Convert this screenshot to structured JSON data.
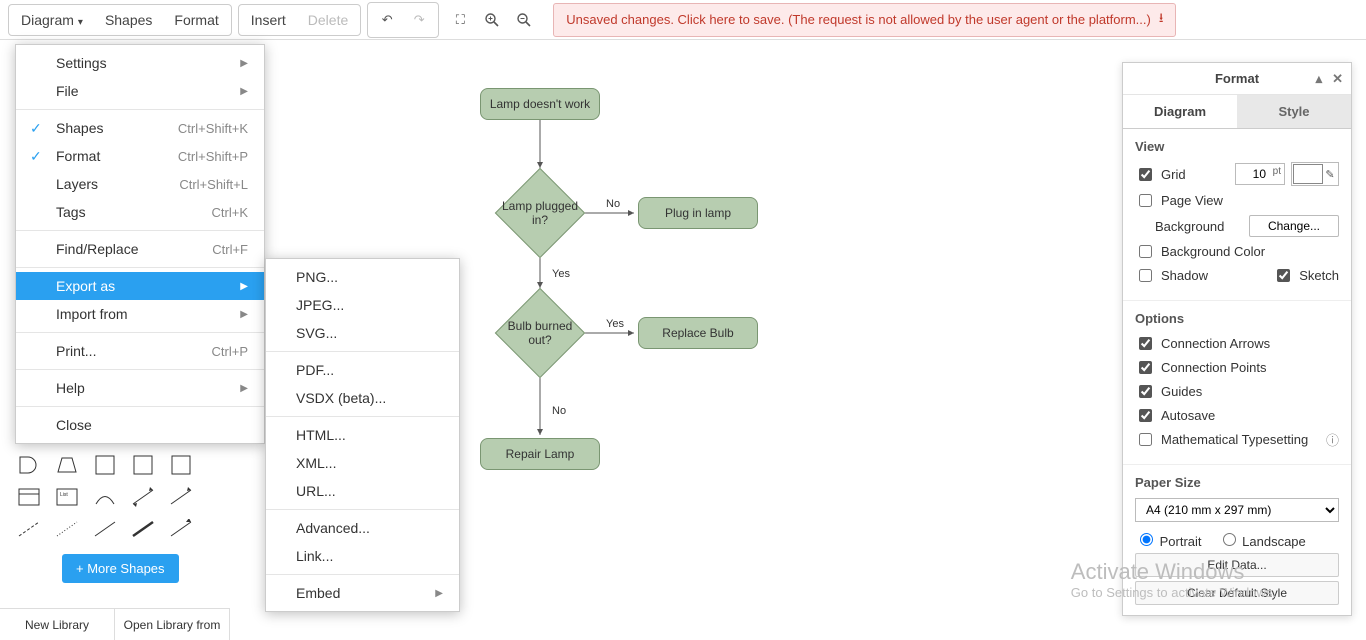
{
  "toolbar": {
    "menus": [
      "Diagram",
      "Shapes",
      "Format"
    ],
    "insert": "Insert",
    "delete": "Delete"
  },
  "alert": "Unsaved changes. Click here to save. (The request is not allowed by the user agent or the platform...)",
  "diagram_menu": {
    "settings": "Settings",
    "file": "File",
    "shapes": {
      "label": "Shapes",
      "shortcut": "Ctrl+Shift+K"
    },
    "format": {
      "label": "Format",
      "shortcut": "Ctrl+Shift+P"
    },
    "layers": {
      "label": "Layers",
      "shortcut": "Ctrl+Shift+L"
    },
    "tags": {
      "label": "Tags",
      "shortcut": "Ctrl+K"
    },
    "find": {
      "label": "Find/Replace",
      "shortcut": "Ctrl+F"
    },
    "export": "Export as",
    "import": "Import from",
    "print": {
      "label": "Print...",
      "shortcut": "Ctrl+P"
    },
    "help": "Help",
    "close": "Close"
  },
  "export_menu": {
    "png": "PNG...",
    "jpeg": "JPEG...",
    "svg": "SVG...",
    "pdf": "PDF...",
    "vsdx": "VSDX (beta)...",
    "html": "HTML...",
    "xml": "XML...",
    "url": "URL...",
    "advanced": "Advanced...",
    "link": "Link...",
    "embed": "Embed"
  },
  "flow": {
    "n1": "Lamp doesn't work",
    "n2": "Lamp plugged in?",
    "n3": "Plug in lamp",
    "n4": "Bulb burned out?",
    "n5": "Replace Bulb",
    "n6": "Repair Lamp",
    "yes": "Yes",
    "no": "No"
  },
  "shapes_panel": {
    "more": "+ More Shapes"
  },
  "bottom": {
    "new": "New Library",
    "open": "Open Library from"
  },
  "format_panel": {
    "title": "Format",
    "tab_diagram": "Diagram",
    "tab_style": "Style",
    "view": "View",
    "grid": "Grid",
    "grid_val": "10",
    "grid_unit": "pt",
    "page_view": "Page View",
    "background": "Background",
    "change": "Change...",
    "bg_color": "Background Color",
    "shadow": "Shadow",
    "sketch": "Sketch",
    "options": "Options",
    "conn_arrows": "Connection Arrows",
    "conn_points": "Connection Points",
    "guides": "Guides",
    "autosave": "Autosave",
    "math": "Mathematical Typesetting",
    "paper": "Paper Size",
    "paper_val": "A4 (210 mm x 297 mm)",
    "portrait": "Portrait",
    "landscape": "Landscape",
    "edit_data": "Edit Data...",
    "clear_style": "Clear Default Style"
  },
  "watermark": {
    "t": "Activate Windows",
    "s": "Go to Settings to activate Windows."
  },
  "chart_data": {
    "type": "flowchart",
    "nodes": [
      {
        "id": "n1",
        "shape": "terminator",
        "label": "Lamp doesn't work"
      },
      {
        "id": "n2",
        "shape": "decision",
        "label": "Lamp plugged in?"
      },
      {
        "id": "n3",
        "shape": "process",
        "label": "Plug in lamp"
      },
      {
        "id": "n4",
        "shape": "decision",
        "label": "Bulb burned out?"
      },
      {
        "id": "n5",
        "shape": "process",
        "label": "Replace Bulb"
      },
      {
        "id": "n6",
        "shape": "terminator",
        "label": "Repair Lamp"
      }
    ],
    "edges": [
      {
        "from": "n1",
        "to": "n2",
        "label": ""
      },
      {
        "from": "n2",
        "to": "n3",
        "label": "No"
      },
      {
        "from": "n2",
        "to": "n4",
        "label": "Yes"
      },
      {
        "from": "n4",
        "to": "n5",
        "label": "Yes"
      },
      {
        "from": "n4",
        "to": "n6",
        "label": "No"
      }
    ]
  }
}
